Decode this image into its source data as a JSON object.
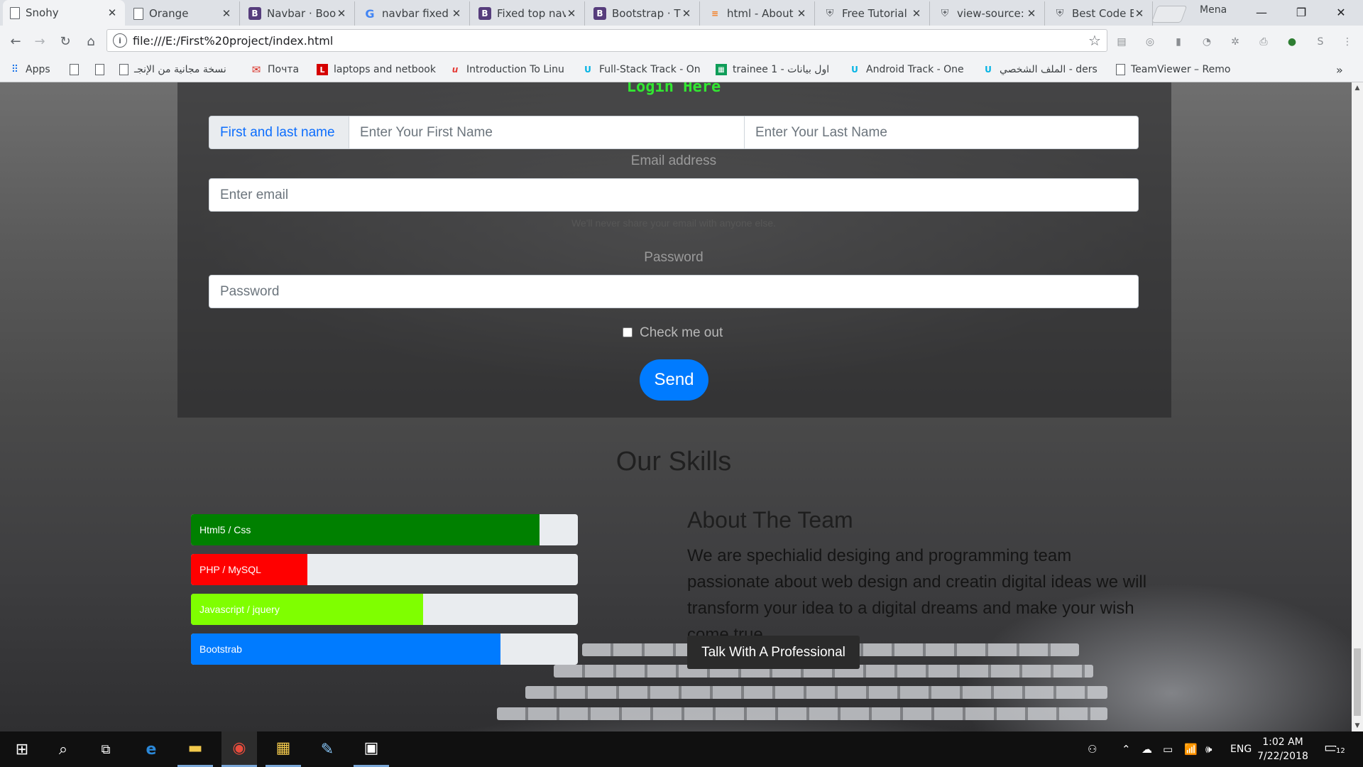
{
  "browser": {
    "tabs": [
      {
        "title": "Snohy",
        "icon": "document-icon",
        "active": true
      },
      {
        "title": "Orange",
        "icon": "document-icon"
      },
      {
        "title": "Navbar · Boo",
        "icon": "bootstrap-icon"
      },
      {
        "title": "navbar fixed t",
        "icon": "google-icon"
      },
      {
        "title": "Fixed top nav",
        "icon": "bootstrap-icon"
      },
      {
        "title": "Bootstrap · T",
        "icon": "bootstrap-icon"
      },
      {
        "title": "html - About",
        "icon": "stackoverflow-icon"
      },
      {
        "title": "Free Tutorial",
        "icon": "shield-icon"
      },
      {
        "title": "view-source:",
        "icon": "shield-icon"
      },
      {
        "title": "Best Code Ed",
        "icon": "shield-icon"
      }
    ],
    "profile_name": "Mena",
    "url": "file:///E:/First%20project/index.html",
    "bookmarks": [
      {
        "label": "Apps",
        "icon": "apps-grid-icon"
      },
      {
        "label": "",
        "icon": "document-icon"
      },
      {
        "label": "",
        "icon": "document-icon"
      },
      {
        "label": "نسخة مجانية من الإنجـ",
        "icon": "document-icon"
      },
      {
        "label": "Почта",
        "icon": "mail-icon"
      },
      {
        "label": "laptops and netbook",
        "icon": "l-logo-icon"
      },
      {
        "label": "Introduction To Linu",
        "icon": "udemy-icon"
      },
      {
        "label": "Full-Stack Track - On",
        "icon": "udacity-icon"
      },
      {
        "label": "trainee 1 - اول بيانات",
        "icon": "sheets-icon"
      },
      {
        "label": "Android Track - One",
        "icon": "udacity-icon"
      },
      {
        "label": "الملف الشخصي - ders",
        "icon": "udacity-icon"
      },
      {
        "label": "TeamViewer – Remo",
        "icon": "document-icon"
      }
    ]
  },
  "page": {
    "login_title": "Login Here",
    "name_label": "First and last name",
    "first_name_placeholder": "Enter Your First Name",
    "last_name_placeholder": "Enter Your Last Name",
    "email_label": "Email address",
    "email_placeholder": "Enter email",
    "email_help": "We'll never share your email with anyone else.",
    "password_label": "Password",
    "password_placeholder": "Password",
    "remember_label": "Check me out",
    "send_label": "Send",
    "skills_heading": "Our Skills",
    "skills": [
      {
        "name": "Html5 / Css",
        "percent": 90,
        "color": "#008000"
      },
      {
        "name": "PHP / MySQL",
        "percent": 30,
        "color": "#ff0000"
      },
      {
        "name": "Javascript / jquery",
        "percent": 60,
        "color": "#7fff00"
      },
      {
        "name": "Bootstrab",
        "percent": 80,
        "color": "#007bff"
      }
    ],
    "about_title": "About The Team",
    "about_text": "We are spechialid desiging and programming team passionate about web design and creatin digital ideas we will transform your idea to a digital dreams and make your wish come true",
    "cta_label": "Talk With A Professional"
  },
  "taskbar": {
    "apps": [
      "start-icon",
      "search-icon",
      "task-view-icon",
      "edge-icon",
      "file-explorer-icon",
      "chrome-icon",
      "video-editor-icon",
      "paint-icon",
      "photos-icon"
    ],
    "language": "ENG",
    "time": "1:02 AM",
    "date": "7/22/2018",
    "notification_count": "12"
  }
}
